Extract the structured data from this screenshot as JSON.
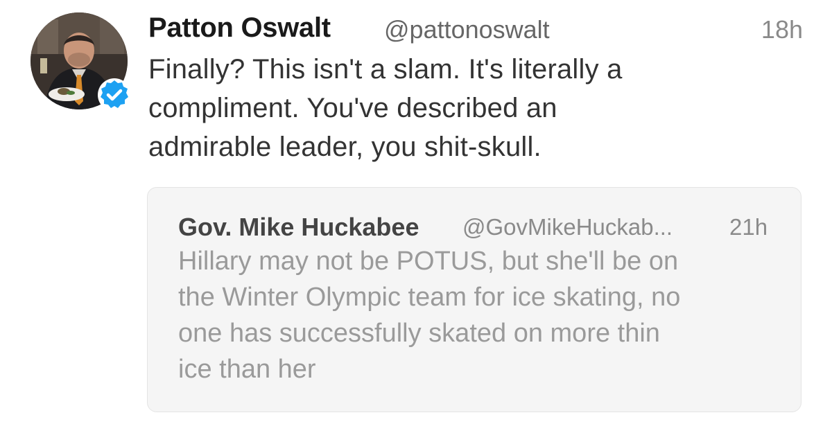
{
  "tweet": {
    "author_name": "Patton Oswalt",
    "author_handle": "@pattonoswalt",
    "timestamp": "18h",
    "avatar": "profile-photo",
    "verified_icon": "verified-badge-icon",
    "text_lines": [
      "Finally? This isn't a slam. It's literally a",
      "compliment. You've described an",
      "admirable leader, you shit-skull."
    ]
  },
  "quoted_tweet": {
    "author_name": "Gov. Mike Huckabee",
    "author_handle": "@GovMikeHuckab...",
    "timestamp": "21h",
    "text_lines": [
      "Hillary may not be POTUS, but she'll be on",
      "the Winter Olympic team for ice skating, no",
      "one has successfully skated on more thin",
      "ice than her"
    ]
  },
  "colors": {
    "verified_blue": "#1da1f2",
    "card_background": "#f5f5f5",
    "quote_text": "#9a9a9a"
  }
}
